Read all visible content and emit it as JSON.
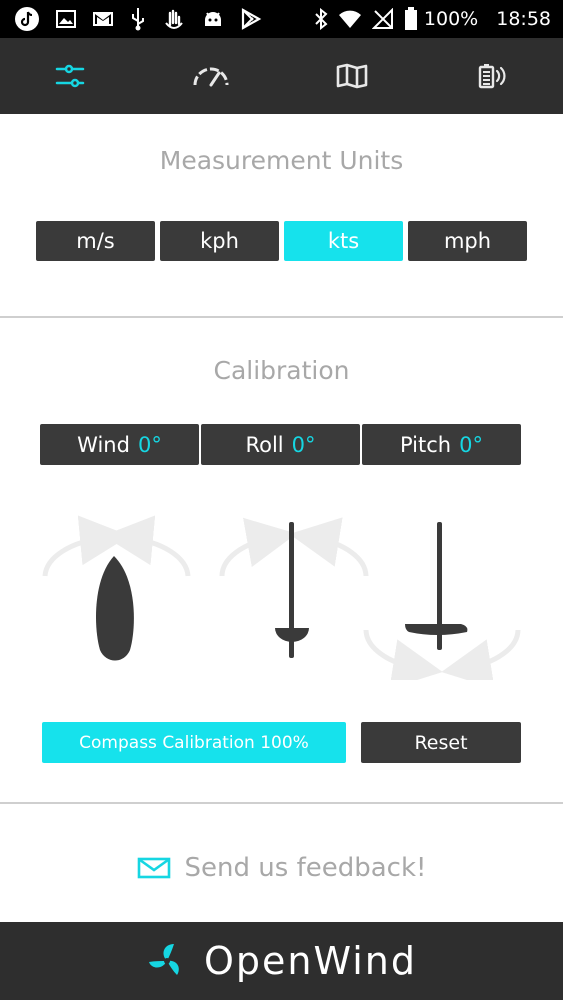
{
  "status_bar": {
    "battery_percent": "100%",
    "time": "18:58",
    "icons": [
      "tiktok-icon",
      "image-icon",
      "gmail-icon",
      "usb-icon",
      "hand-icon",
      "android-icon",
      "play-store-icon",
      "bluetooth-icon",
      "wifi-icon",
      "no-signal-icon",
      "battery-icon"
    ]
  },
  "top_nav": {
    "tabs": [
      {
        "icon": "sliders-icon",
        "active": true,
        "color": "#16d6e2"
      },
      {
        "icon": "speedometer-icon",
        "active": false
      },
      {
        "icon": "map-icon",
        "active": false
      },
      {
        "icon": "battery-signal-icon",
        "active": false
      }
    ]
  },
  "measurement_units": {
    "title": "Measurement Units",
    "options": [
      "m/s",
      "kph",
      "kts",
      "mph"
    ],
    "selected": "kts"
  },
  "calibration": {
    "title": "Calibration",
    "items": [
      {
        "label": "Wind",
        "value": "0°"
      },
      {
        "label": "Roll",
        "value": "0°"
      },
      {
        "label": "Pitch",
        "value": "0°"
      }
    ],
    "compass_button": "Compass Calibration 100%",
    "reset_button": "Reset"
  },
  "feedback": {
    "label": "Send us feedback!"
  },
  "footer": {
    "brand": "OpenWind"
  },
  "colors": {
    "accent": "#16e2ec",
    "dark": "#2e2e2e",
    "button_dark": "#3a3a3a",
    "muted_text": "#a8a8a8"
  }
}
